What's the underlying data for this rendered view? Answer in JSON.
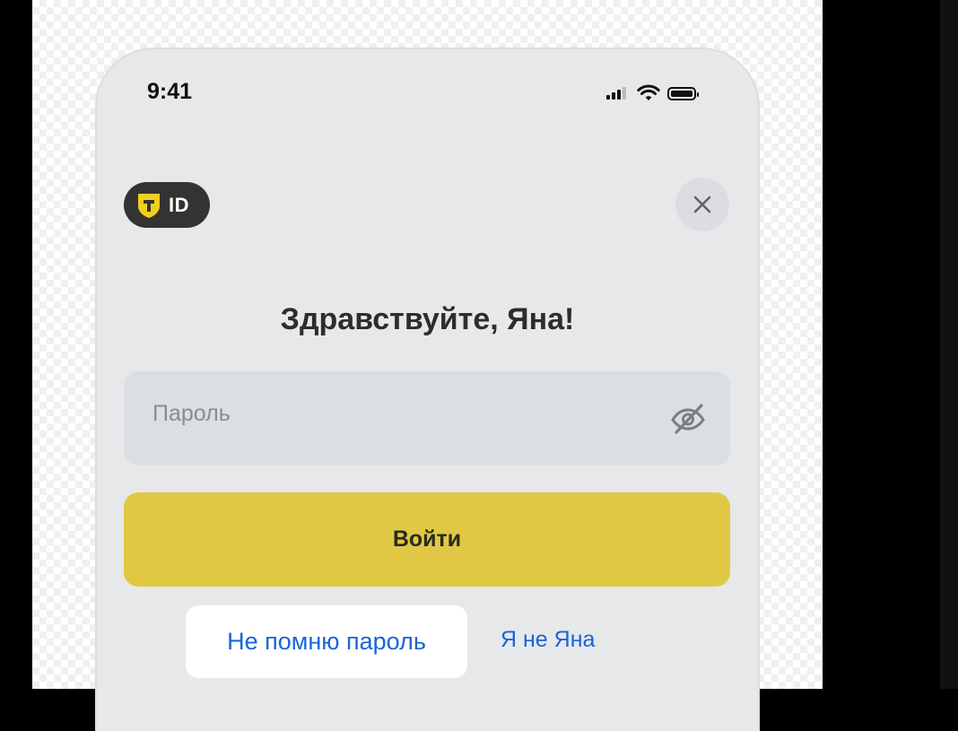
{
  "status_bar": {
    "time": "9:41",
    "icons": [
      "cellular-signal-icon",
      "wifi-icon",
      "battery-icon"
    ]
  },
  "header": {
    "badge_text": "ID",
    "badge_icon": "shield-t-icon",
    "close_icon": "close-icon"
  },
  "main": {
    "title": "Здравствуйте, Яна!",
    "password": {
      "placeholder": "Пароль",
      "value": "",
      "toggle_icon": "eye-off-icon"
    },
    "login_button": "Войти",
    "forgot_password": "Не помню пароль",
    "not_me": "Я не Яна"
  },
  "colors": {
    "accent_yellow": "#e1c844",
    "link_blue": "#1a64d8",
    "badge_dark": "#333333",
    "screen_bg": "#e7e8ea",
    "field_bg": "#dbdfe1"
  }
}
